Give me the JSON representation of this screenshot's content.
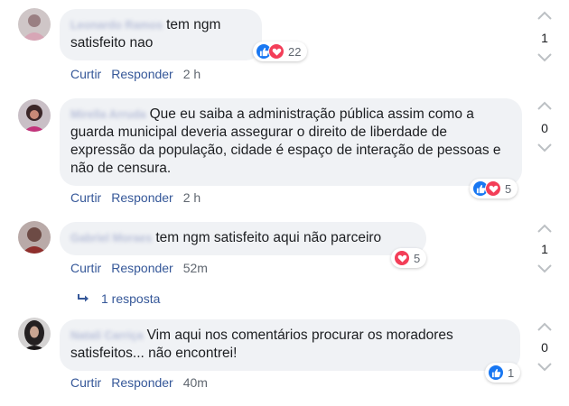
{
  "comments": [
    {
      "author": "Leonardo Ramos",
      "text": "tem ngm satisfeito nao",
      "reaction_count": "22",
      "reactions": [
        "like-icon",
        "love-icon"
      ],
      "like_label": "Curtir",
      "reply_label": "Responder",
      "time": "2 h",
      "score": "1"
    },
    {
      "author": "Mirella Arruda",
      "text": "Que eu saiba a administração pública assim como a guarda municipal deveria assegurar o direito de liberdade de expressão da população, cidade é espaço de interação de pessoas e não de censura.",
      "reaction_count": "5",
      "reactions": [
        "like-icon",
        "love-icon"
      ],
      "like_label": "Curtir",
      "reply_label": "Responder",
      "time": "2 h",
      "score": "0"
    },
    {
      "author": "Gabriel Moraes",
      "text": "tem ngm satisfeito aqui não parceiro",
      "reaction_count": "5",
      "reactions": [
        "love-icon"
      ],
      "like_label": "Curtir",
      "reply_label": "Responder",
      "time": "52m",
      "score": "1",
      "replies_label": "1 resposta"
    },
    {
      "author": "Natali Carriça",
      "text": "Vim aqui nos comentários procurar os moradores satisfeitos... não encontrei!",
      "reaction_count": "1",
      "reactions": [
        "like-icon"
      ],
      "like_label": "Curtir",
      "reply_label": "Responder",
      "time": "40m",
      "score": "0"
    }
  ],
  "colors": {
    "link": "#365899",
    "bubble": "#f0f2f5",
    "like": "#1877f2",
    "love": "#f33e58",
    "vote_arrow": "#bcc0c4"
  }
}
